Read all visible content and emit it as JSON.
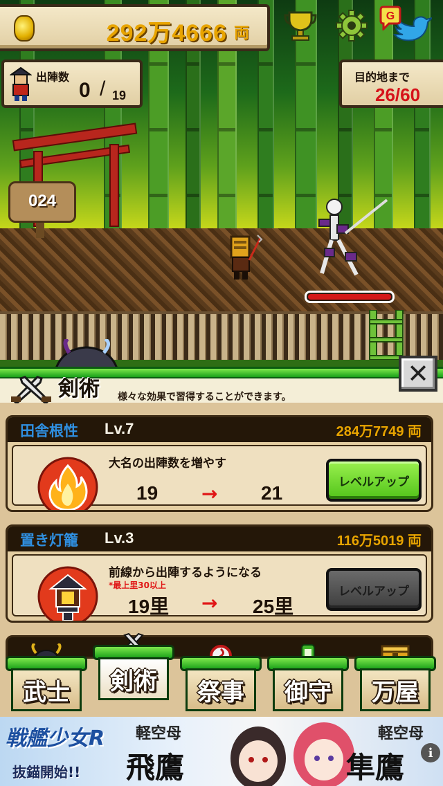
{
  "hud": {
    "gold_amount": "292万4666",
    "gold_unit": "両",
    "sortie_label": "出陣数",
    "sortie_current": "0",
    "sortie_separator": "/",
    "sortie_max": "19",
    "destination_label": "目的地まで",
    "destination_value": "26/60",
    "icons": [
      "coin-icon",
      "trophy-icon",
      "gear-icon",
      "gree-icon",
      "bird-icon"
    ]
  },
  "scene": {
    "stage_number": "024",
    "enemy_hp_fraction": 1.0
  },
  "menu": {
    "title": "剣術",
    "subtitle": "様々な効果で習得することができます。",
    "close_label": "✕"
  },
  "skills": [
    {
      "name": "田舎根性",
      "level": "Lv.7",
      "cost": "284万7749 両",
      "description": "大名の出陣数を増やす",
      "note": "",
      "from": "19",
      "arrow": "→",
      "to": "21",
      "button": "レベルアップ",
      "button_enabled": true,
      "icon": "fire-icon"
    },
    {
      "name": "置き灯籠",
      "level": "Lv.3",
      "cost": "116万5019 両",
      "description": "前線から出陣するようになる",
      "note": "*最上里30以上",
      "from": "19里",
      "arrow": "→",
      "to": "25里",
      "button": "レベルアップ",
      "button_enabled": false,
      "icon": "lantern-icon"
    }
  ],
  "nav": [
    {
      "label": "武士",
      "emblem": "helmet-icon"
    },
    {
      "label": "剣術",
      "emblem": "swords-icon"
    },
    {
      "label": "祭事",
      "emblem": "drum-icon"
    },
    {
      "label": "御守",
      "emblem": "charm-icon"
    },
    {
      "label": "万屋",
      "emblem": "chest-icon"
    }
  ],
  "ad": {
    "logo": "戦艦少女R",
    "tagline": "抜錨開始!!",
    "left_sub": "軽空母",
    "left_name": "飛鷹",
    "right_sub": "軽空母",
    "right_name": "隼鷹",
    "info": "i"
  },
  "colors": {
    "gold": "#e8a400",
    "danger_red": "#d6121a",
    "skill_name_blue": "#2f8fe0",
    "menu_green": "#19a019"
  }
}
